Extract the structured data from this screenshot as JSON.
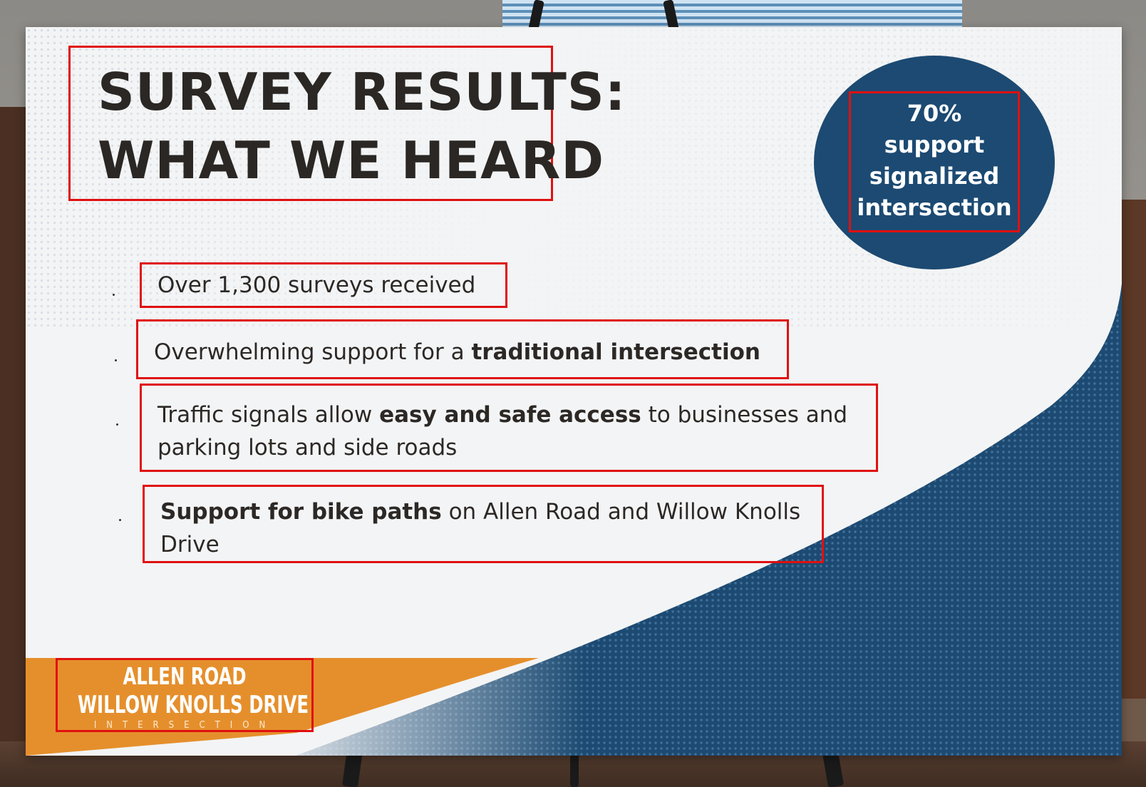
{
  "poster": {
    "title_line1": "SURVEY RESULTS:",
    "title_line2": "WHAT WE HEARD",
    "badge_lines": [
      "70%",
      "support",
      "signalized",
      "intersection"
    ],
    "bullets": [
      {
        "segments": [
          {
            "text": "Over 1,300 surveys received",
            "bold": false
          }
        ]
      },
      {
        "segments": [
          {
            "text": "Overwhelming support for a ",
            "bold": false
          },
          {
            "text": "traditional intersection",
            "bold": true
          }
        ]
      },
      {
        "segments": [
          {
            "text": "Traffic signals allow ",
            "bold": false
          },
          {
            "text": "easy and safe access",
            "bold": true
          },
          {
            "text": " to businesses and",
            "bold": false
          },
          {
            "text": "\nparking lots and side roads",
            "bold": false
          }
        ]
      },
      {
        "segments": [
          {
            "text": "Support for bike paths",
            "bold": true
          },
          {
            "text": " on Allen Road and Willow Knolls",
            "bold": false
          },
          {
            "text": "\nDrive",
            "bold": false
          }
        ]
      }
    ],
    "logo": {
      "line1": "ALLEN ROAD",
      "line2": "WILLOW KNOLLS DRIVE",
      "line3": "INTERSECTION"
    }
  },
  "colors": {
    "accent_blue": "#1c4a72",
    "accent_orange": "#e58f2c",
    "title_text": "#2a2724",
    "highlight_box": "#e01010"
  }
}
